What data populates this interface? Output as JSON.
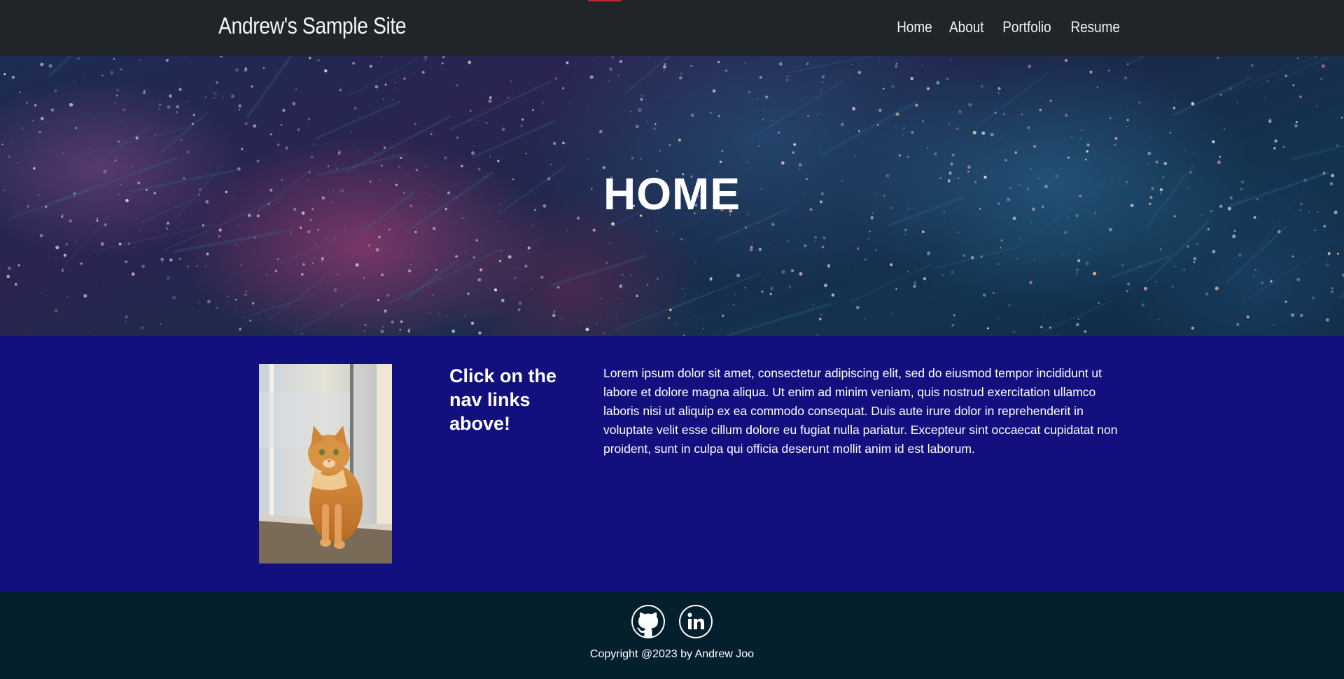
{
  "header": {
    "brand": "Andrew's Sample Site",
    "nav": [
      "Home",
      "About",
      "Portfolio",
      "Resume"
    ]
  },
  "hero": {
    "title": "HOME"
  },
  "main": {
    "heading": "Click on the nav links above!",
    "body": "Lorem ipsum dolor sit amet, consectetur adipiscing elit, sed do eiusmod tempor incididunt ut labore et dolore magna aliqua. Ut enim ad minim veniam, quis nostrud exercitation ullamco laboris nisi ut aliquip ex ea commodo consequat. Duis aute irure dolor in reprehenderit in voluptate velit esse cillum dolore eu fugiat nulla pariatur. Excepteur sint occaecat cupidatat non proident, sunt in culpa qui officia deserunt mollit anim id est laborum.",
    "image_icon": "cat-photo"
  },
  "footer": {
    "social_icons": [
      "github-icon",
      "linkedin-icon"
    ],
    "copyright": "Copyright @2023 by Andrew Joo"
  },
  "colors": {
    "navbar": "#212428",
    "content_bg": "#12107e",
    "footer_bg": "#04202d",
    "accent": "#c0282e"
  }
}
